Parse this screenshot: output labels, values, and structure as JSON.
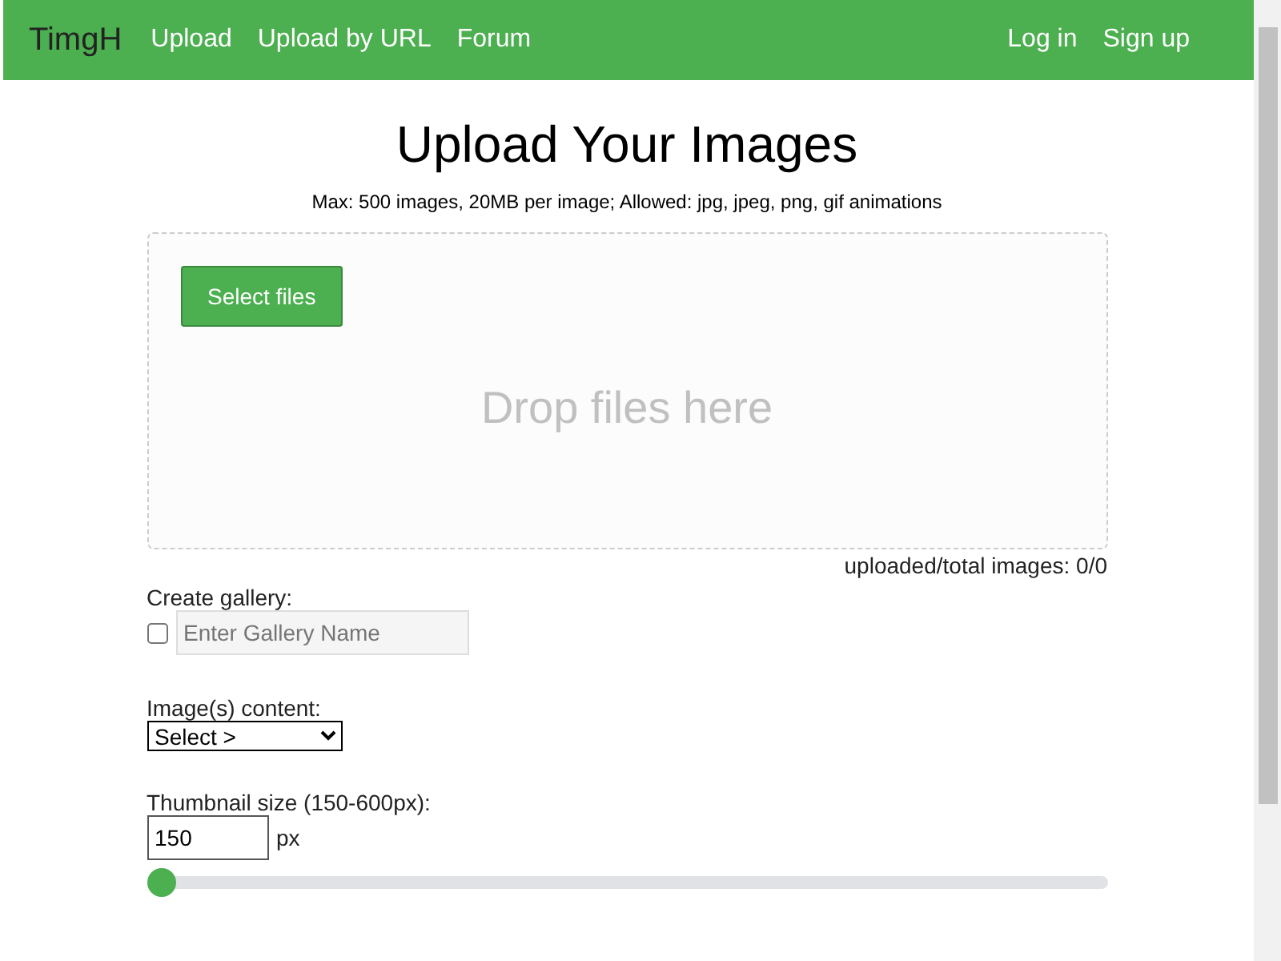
{
  "navbar": {
    "brand": "TimgH",
    "links": [
      "Upload",
      "Upload by URL",
      "Forum"
    ],
    "account_links": [
      "Log in",
      "Sign up"
    ]
  },
  "heading": "Upload Your Images",
  "limits": "Max: 500 images, 20MB per image; Allowed: jpg, jpeg, png, gif animations",
  "dropzone": {
    "button": "Select files",
    "hint": "Drop files here"
  },
  "counter": "uploaded/total images: 0/0",
  "gallery": {
    "label": "Create gallery:",
    "checked": false,
    "placeholder": "Enter Gallery Name"
  },
  "content": {
    "label": "Image(s) content:",
    "value": "Select >"
  },
  "thumbnail": {
    "label": "Thumbnail size (150-600px):",
    "value": "150",
    "unit": "px",
    "level": 0
  }
}
